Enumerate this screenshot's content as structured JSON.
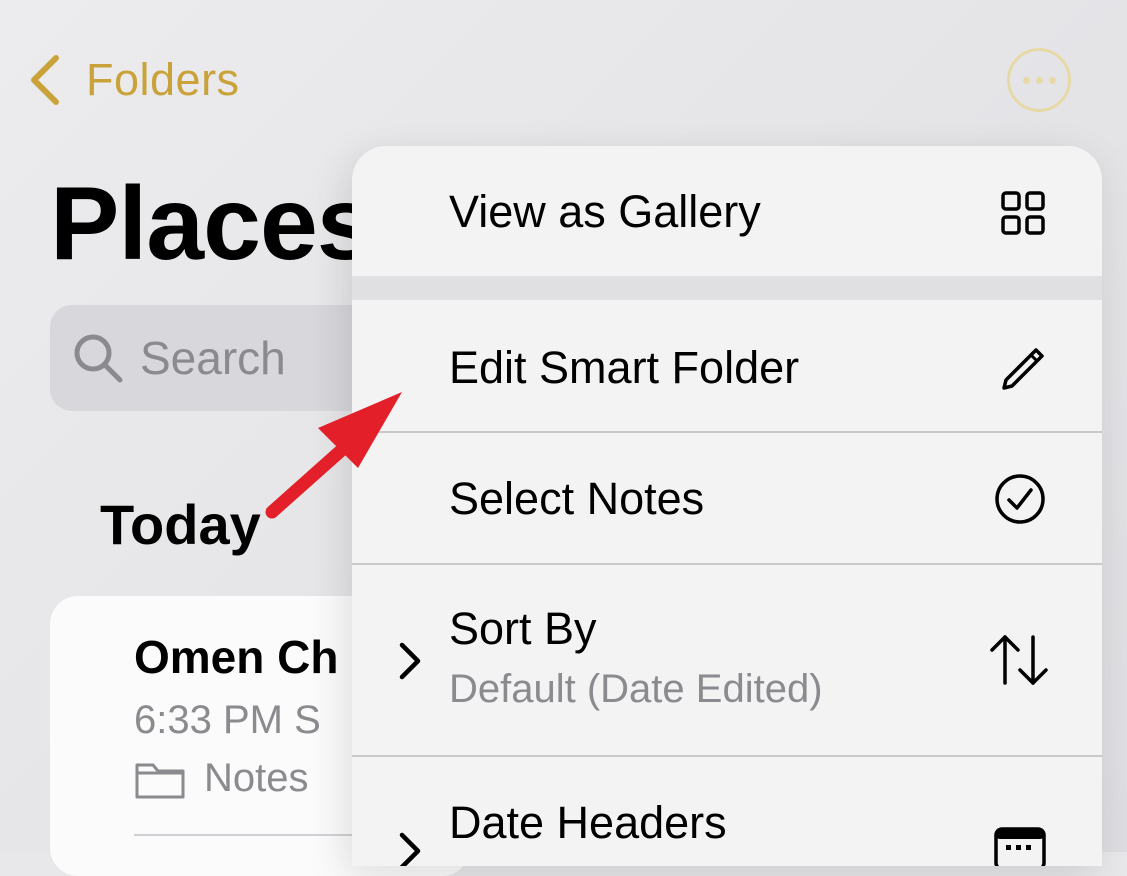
{
  "nav": {
    "back_label": "Folders"
  },
  "page": {
    "title": "Places"
  },
  "search": {
    "placeholder": "Search"
  },
  "section": {
    "title": "Today"
  },
  "note": {
    "title": "Omen Ch",
    "time": "6:33 PM  S",
    "folder": "Notes"
  },
  "menu": {
    "items": [
      {
        "label": "View as Gallery",
        "icon": "grid-icon"
      },
      {
        "label": "Edit Smart Folder",
        "icon": "pencil-icon"
      },
      {
        "label": "Select Notes",
        "icon": "checkmark-circle-icon"
      },
      {
        "label": "Sort By",
        "sub": "Default (Date Edited)",
        "icon": "sort-arrows-icon"
      },
      {
        "label": "Date Headers",
        "icon": "calendar-icon"
      }
    ]
  },
  "colors": {
    "accent": "#c9a33a",
    "arrow": "#e3202a"
  }
}
